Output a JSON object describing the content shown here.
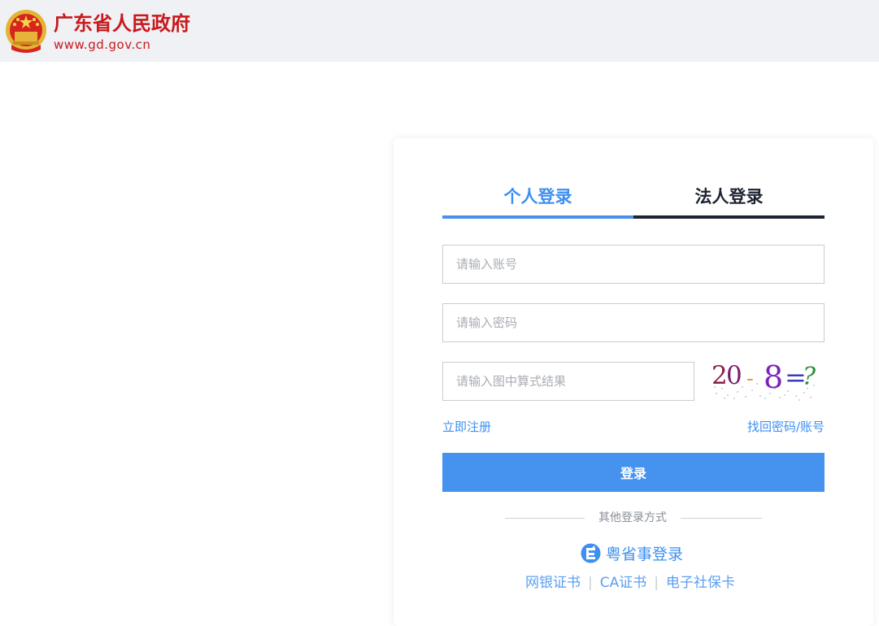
{
  "header": {
    "title": "广东省人民政府",
    "url": "www.gd.gov.cn",
    "emblem_icon": "national-emblem-icon"
  },
  "login": {
    "tabs": [
      {
        "label": "个人登录",
        "active": true
      },
      {
        "label": "法人登录",
        "active": false
      }
    ],
    "account_placeholder": "请输入账号",
    "password_placeholder": "请输入密码",
    "captcha_placeholder": "请输入图中算式结果",
    "captcha_text": "20-8=?",
    "register_link": "立即注册",
    "recover_link": "找回密码/账号",
    "submit_label": "登录",
    "other_methods_label": "其他登录方式",
    "yue_login_label": "粤省事登录",
    "yue_icon": "yueshengshi-icon",
    "alt_methods": [
      "网银证书",
      "CA证书",
      "电子社保卡"
    ],
    "alt_separator": "|"
  },
  "colors": {
    "brand_red": "#c8191b",
    "accent_blue": "#4593ef",
    "header_bg": "#eff1f4",
    "dark_tab": "#1d2431"
  }
}
